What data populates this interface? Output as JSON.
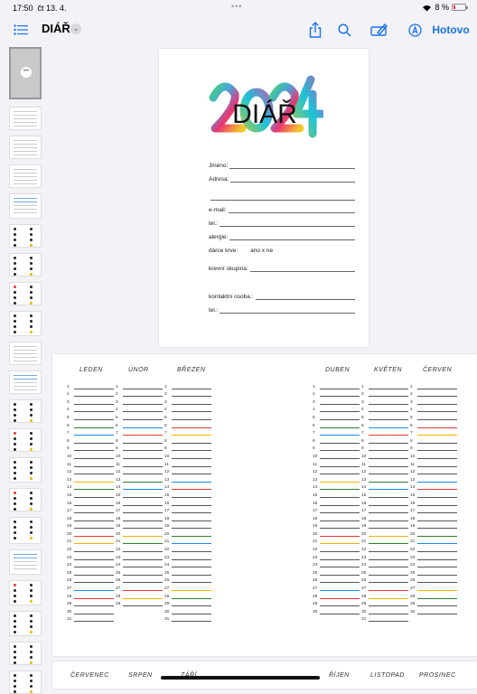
{
  "status_bar": {
    "time": "17:50",
    "date": "čt 13. 4.",
    "dots": "•••",
    "battery": "8 %"
  },
  "toolbar": {
    "title": "DIÁŘ",
    "done": "Hotovo"
  },
  "icons": {
    "sidebar": "sidebar-list-icon",
    "share": "share-icon",
    "search": "search-icon",
    "edit": "edit-icon",
    "markup": "markup-icon",
    "wifi": "wifi-icon",
    "battery": "battery-icon"
  },
  "cover": {
    "logo_text": "DIÁŘ",
    "logo_year": "2024",
    "fields": [
      {
        "label": "Jméno:",
        "value": ""
      },
      {
        "label": "Adresa:",
        "value": ""
      },
      {
        "label": "",
        "value": ""
      },
      {
        "label": "e-mail:",
        "value": ""
      },
      {
        "label": "tel.:",
        "value": ""
      },
      {
        "label": "alergie:",
        "value": ""
      },
      {
        "label": "dárce krve:",
        "value": "ano x ne"
      },
      {
        "label": "krevní skupina:",
        "value": ""
      },
      {
        "label": "kontaktní osoba.:",
        "value": ""
      },
      {
        "label": "tel.:",
        "value": ""
      }
    ]
  },
  "calendar": {
    "left_months": [
      "LEDEN",
      "ÚNOR",
      "BŘEZEN"
    ],
    "right_months": [
      "DUBEN",
      "KVĚTEN",
      "ČERVEN"
    ],
    "days_in_month": [
      31,
      29,
      31,
      30,
      31,
      30
    ],
    "bottom_months": [
      "ČERVENEC",
      "SRPEN",
      "ZÁŘÍ",
      "ŘÍJEN",
      "LISTOPAD",
      "PROSINEC"
    ]
  }
}
